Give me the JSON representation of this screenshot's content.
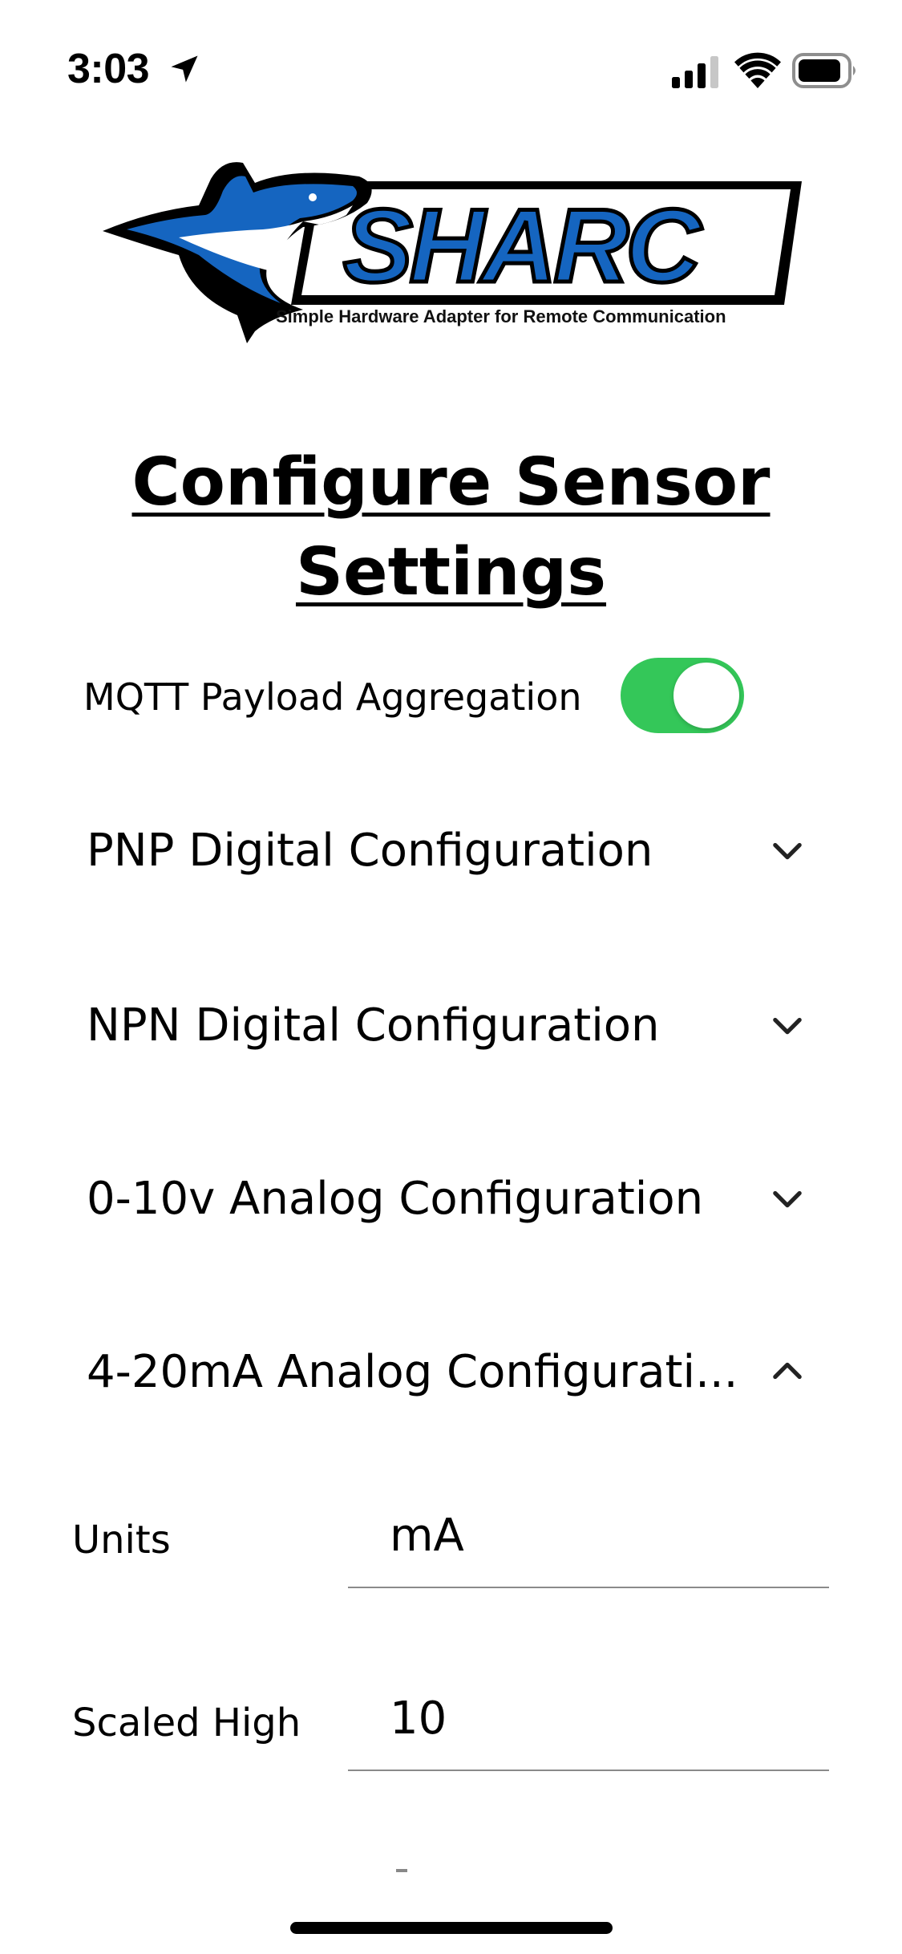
{
  "status_bar": {
    "time": "3:03",
    "icons": [
      "location-arrow-icon",
      "cellular-signal-icon",
      "wifi-icon",
      "battery-icon"
    ]
  },
  "logo": {
    "wordmark": "SHARC",
    "caption": "Simple Hardware Adapter for Remote Communication",
    "brand_blue": "#1565c0"
  },
  "title": {
    "line1": "Configure Sensor",
    "line2": "Settings"
  },
  "mqtt_toggle": {
    "label": "MQTT Payload Aggregation",
    "enabled": true,
    "on_color": "#34c759"
  },
  "sections": [
    {
      "label": "PNP Digital Configuration",
      "expanded": false,
      "icon": "chevron-down-icon"
    },
    {
      "label": "NPN Digital Configuration",
      "expanded": false,
      "icon": "chevron-down-icon"
    },
    {
      "label": "0-10v Analog Configuration",
      "expanded": false,
      "icon": "chevron-down-icon"
    },
    {
      "label": "4-20mA Analog Configurati...",
      "expanded": true,
      "icon": "chevron-up-icon"
    }
  ],
  "fields": {
    "units": {
      "label": "Units",
      "value": "mA"
    },
    "scaled_high": {
      "label": "Scaled High",
      "value": "10"
    }
  }
}
